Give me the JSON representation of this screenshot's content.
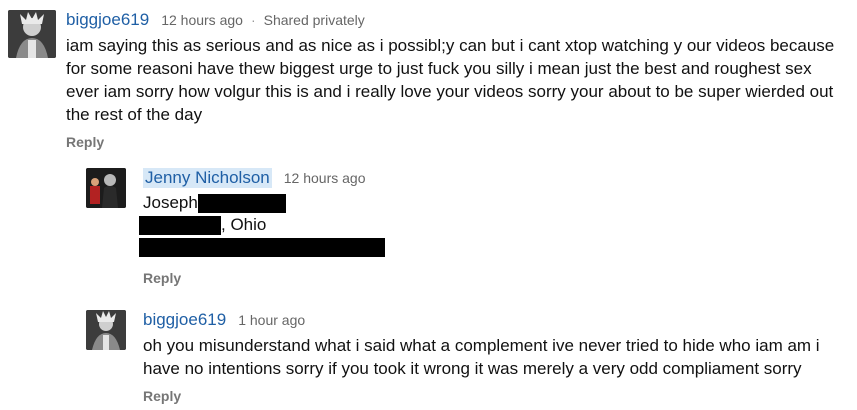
{
  "comments": [
    {
      "author": "biggjoe619",
      "time": "12 hours ago",
      "visibility": "Shared privately",
      "text": "iam saying this as serious and as nice as i possibl;y can but i cant xtop watching y our videos because for some reasoni have thew biggest urge to just fuck you silly i mean just the best and roughest sex ever iam sorry how volgur this is and i really love your videos sorry your about to be super wierded out the rest of the day",
      "reply_label": "Reply"
    },
    {
      "author": "Jenny Nicholson",
      "time": "12 hours ago",
      "line1": "Joseph",
      "line2": ", Ohio",
      "reply_label": "Reply"
    },
    {
      "author": "biggjoe619",
      "time": "1 hour ago",
      "text": "oh you misunderstand what i said what a complement ive never tried to hide who iam am i have no intentions sorry if you took it wrong it was merely a very odd compliament sorry",
      "reply_label": "Reply"
    }
  ],
  "icons": {
    "avatar_biggjoe": "avatar-icon",
    "avatar_jenny": "avatar-icon"
  },
  "colors": {
    "author_link": "#1f5fa5",
    "highlight": "#d7e8f7",
    "redaction": "#000000"
  }
}
